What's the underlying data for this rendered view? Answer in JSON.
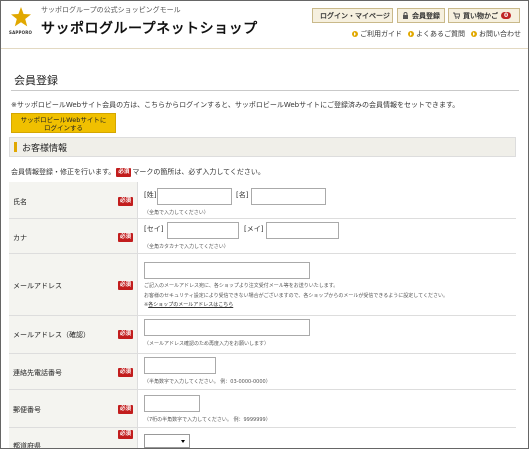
{
  "header": {
    "tagline": "サッポログループの公式ショッピングモール",
    "logo_text": "SAPPORO",
    "shop_title": "サッポログループネットショップ",
    "login_btn": "ログイン・マイページ",
    "register_btn": "会員登録",
    "cart_btn": "買い物かご",
    "cart_count": "0",
    "subnav": [
      "ご利用ガイド",
      "よくあるご質問",
      "お問い合わせ"
    ]
  },
  "page": {
    "title": "会員登録",
    "notice": "※サッポロビールWebサイト会員の方は、こちらからログインすると、サッポロビールWebサイトにご登録済みの会員情報をセットできます。",
    "sapporo_login_line1": "サッポロビールWebサイトに",
    "sapporo_login_line2": "ログインする",
    "section_title": "お客様情報",
    "intro_before": "会員情報登録・修正を行います。",
    "intro_after": "マークの箇所は、必ず入力してください。",
    "required_label": "必須"
  },
  "form": {
    "name": {
      "label": "氏名",
      "sei_label": "[姓]",
      "mei_label": "[名]",
      "hint": "（全角で入力してください）"
    },
    "kana": {
      "label": "カナ",
      "sei_label": "[セイ]",
      "mei_label": "[メイ]",
      "hint": "（全角カタカナで入力してください）"
    },
    "email": {
      "label": "メールアドレス",
      "hint1": "ご記入のメールアドレス宛に、各ショップより注文受付メール等をお送りいたします。",
      "hint2": "お客様のセキュリティ設定により受信できない場合がございますので、各ショップからのメールが受信できるように設定してください。",
      "hint3_prefix": "※",
      "hint3_link": "各ショップのメールアドレスはこちら"
    },
    "email_confirm": {
      "label": "メールアドレス（確認）",
      "hint": "（メールアドレス確認のため再度入力をお願いします）"
    },
    "phone": {
      "label": "連絡先電話番号",
      "hint": "（半角数字で入力してください。 例：03-0000-0000）"
    },
    "postal": {
      "label": "郵便番号",
      "hint": "（7桁の半角数字で入力してください。 例：9999999）"
    },
    "prefecture": {
      "label": "都道府県",
      "value": ""
    }
  },
  "colors": {
    "accent": "#e1a800",
    "required": "#c21d1d",
    "button_yellow": "#f0c000"
  }
}
